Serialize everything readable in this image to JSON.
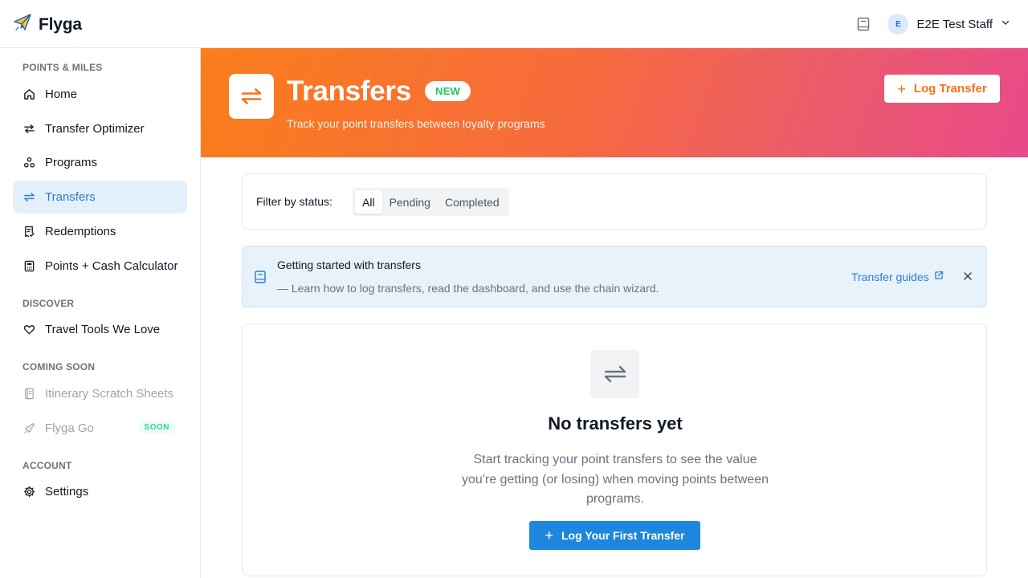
{
  "app": {
    "name": "Flyga"
  },
  "topbar": {
    "guide_icon": "book-icon",
    "user_initial": "E",
    "user_name": "E2E Test Staff"
  },
  "sidebar": {
    "sections": {
      "points_miles": "POINTS & MILES",
      "discover": "DISCOVER",
      "coming_soon": "COMING SOON",
      "account": "ACCOUNT"
    },
    "items": {
      "home": "Home",
      "transfer_optimizer": "Transfer Optimizer",
      "programs": "Programs",
      "transfers": "Transfers",
      "redemptions": "Redemptions",
      "points_cash": "Points + Cash Calculator",
      "travel_tools": "Travel Tools We Love",
      "itinerary": "Itinerary Scratch Sheets",
      "flyga_go": "Flyga Go",
      "settings": "Settings"
    },
    "soon_badge": "SOON",
    "active_item": "transfers"
  },
  "hero": {
    "title": "Transfers",
    "badge": "NEW",
    "subtitle": "Track your point transfers between loyalty programs",
    "button_label": "Log Transfer"
  },
  "filter": {
    "label": "Filter by status:",
    "options": [
      "All",
      "Pending",
      "Completed"
    ],
    "selected": "All"
  },
  "info": {
    "title": "Getting started with transfers",
    "description": "— Learn how to log transfers, read the dashboard, and use the chain wizard.",
    "link_label": "Transfer guides"
  },
  "empty": {
    "title": "No transfers yet",
    "description": "Start tracking your point transfers to see the value you're getting (or losing) when moving points between programs.",
    "button_label": "Log Your First Transfer"
  },
  "colors": {
    "accent_blue": "#1f86de",
    "accent_orange": "#f97316",
    "hero_gradient_start": "#fb7d1b",
    "hero_gradient_end": "#e84a8a",
    "new_badge_green": "#22c55e"
  }
}
